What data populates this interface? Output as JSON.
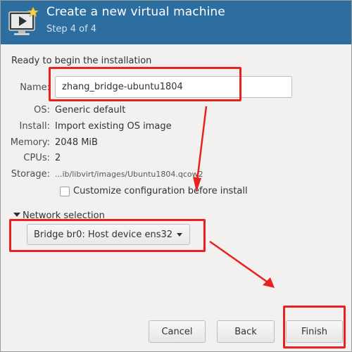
{
  "header": {
    "title": "Create a new virtual machine",
    "step": "Step 4 of 4",
    "icon": "vm-monitor-icon",
    "bg_color": "#2d6ea1"
  },
  "summary": {
    "ready_text": "Ready to begin the installation",
    "name_label": "Name:",
    "name_value": "zhang_bridge-ubuntu1804",
    "os_label": "OS:",
    "os_value": "Generic default",
    "install_label": "Install:",
    "install_value": "Import existing OS image",
    "memory_label": "Memory:",
    "memory_value": "2048 MiB",
    "cpus_label": "CPUs:",
    "cpus_value": "2",
    "storage_label": "Storage:",
    "storage_value": "...ib/libvirt/images/Ubuntu1804.qcow2"
  },
  "customize": {
    "label": "Customize configuration before install",
    "checked": false
  },
  "network": {
    "expander_label": "Network selection",
    "selected": "Bridge br0: Host device ens32"
  },
  "buttons": {
    "cancel": "Cancel",
    "back": "Back",
    "finish": "Finish"
  },
  "annotation_color": "#e8231f"
}
